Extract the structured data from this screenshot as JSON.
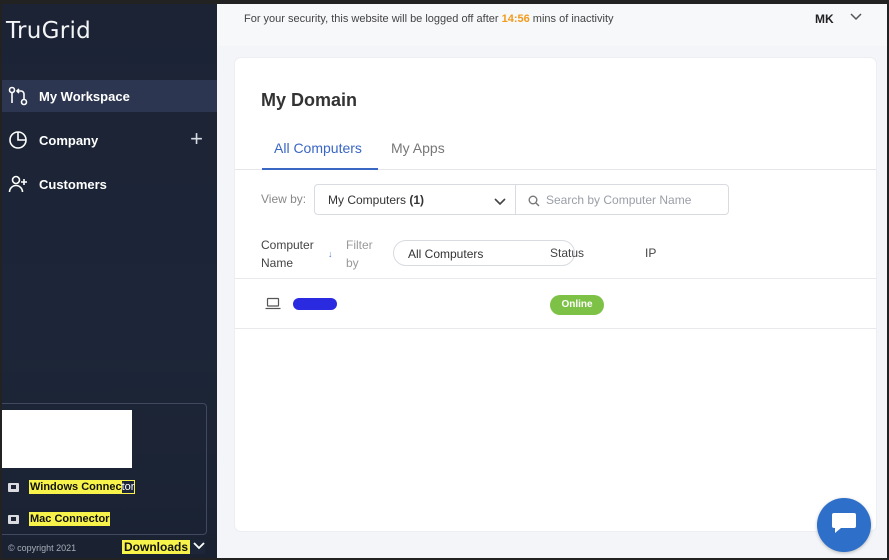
{
  "app": {
    "logo": "TruGrid"
  },
  "sidebar": {
    "items": [
      {
        "label": "My Workspace",
        "icon": "workspace-icon",
        "active": true
      },
      {
        "label": "Company",
        "icon": "pie-chart-icon",
        "active": false
      },
      {
        "label": "Customers",
        "icon": "add-user-icon",
        "active": false
      }
    ],
    "company_action": "+",
    "downloads": {
      "windows_hl_a": "Windows Connec",
      "windows_plain": "tor",
      "mac": "Mac Connector"
    },
    "copyright": "© copyright 2021",
    "downloads_label": "Downloads"
  },
  "header": {
    "security_prefix": "For your security, this website will be logged off after ",
    "timer": "14:56",
    "security_suffix": " mins of inactivity",
    "user_initials": "MK"
  },
  "main": {
    "title": "My Domain",
    "tabs": [
      {
        "label": "All Computers",
        "active": true
      },
      {
        "label": "My Apps",
        "active": false
      }
    ],
    "view_by_label": "View by:",
    "view_by_value": "My Computers",
    "view_by_count": "(1)",
    "search_placeholder": "Search by Computer Name",
    "columns": {
      "computer_name": "Computer Name",
      "filter_by": "Filter by",
      "filter_value": "All Computers",
      "status": "Status",
      "ip": "IP"
    },
    "rows": [
      {
        "name": "",
        "status": "Online",
        "ip": ""
      }
    ]
  },
  "colors": {
    "sidebar_bg": "#1d2638",
    "accent": "#3a66c4",
    "timer": "#f29a1a",
    "online": "#7dc247",
    "chat": "#2e6fc9"
  }
}
